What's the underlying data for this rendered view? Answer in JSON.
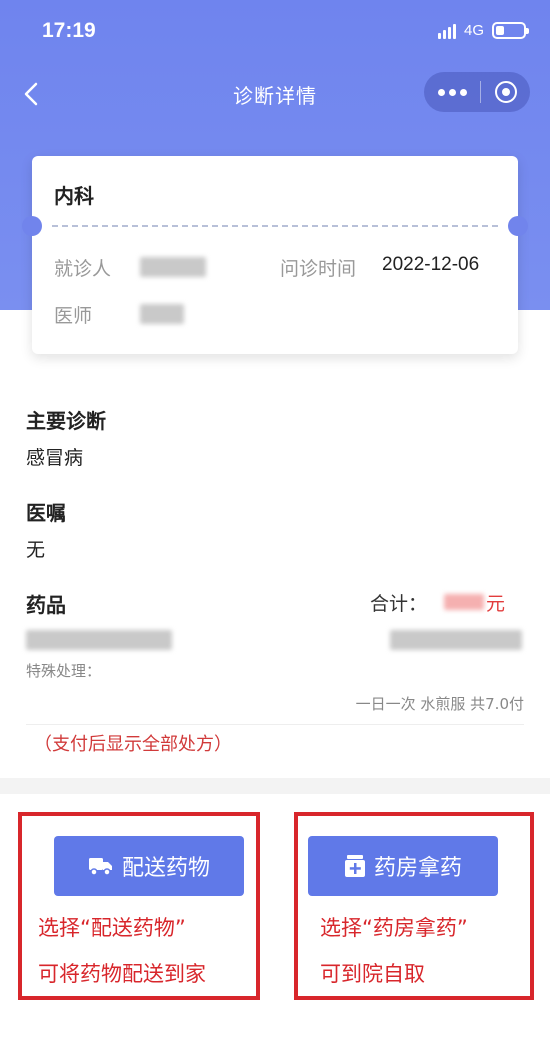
{
  "status_bar": {
    "time": "17:19",
    "network": "4G"
  },
  "nav": {
    "title": "诊断详情"
  },
  "card": {
    "department": "内科",
    "patient_label": "就诊人",
    "time_label": "问诊时间",
    "time_value": "2022-12-06",
    "doctor_label": "医师"
  },
  "diagnosis": {
    "title": "主要诊断",
    "value": "感冒病"
  },
  "advice": {
    "title": "医嘱",
    "value": "无"
  },
  "medicine": {
    "title": "药品",
    "total_label": "合计：",
    "total_unit": "元",
    "special_label": "特殊处理：",
    "dosage": "一日一次 水煎服 共7.0付",
    "notice": "（支付后显示全部处方）"
  },
  "actions": {
    "delivery_label": "配送药物",
    "pharmacy_label": "药房拿药"
  },
  "annotations": {
    "delivery_line1": "选择“配送药物”",
    "delivery_line2": "可将药物配送到家",
    "pharmacy_line1": "选择“药房拿药”",
    "pharmacy_line2": "可到院自取"
  },
  "colors": {
    "header": "#7184ec",
    "button": "#6079e8",
    "annotation": "#d8262b"
  }
}
